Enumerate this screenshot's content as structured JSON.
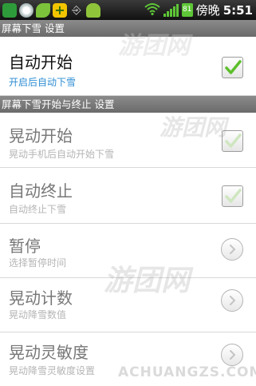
{
  "status_bar": {
    "battery_level": "81",
    "carrier_text": "傍晚",
    "time": "5:51"
  },
  "sections": [
    {
      "header": "屏幕下雪 设置"
    },
    {
      "header": "屏幕下雪开始与终止 设置"
    }
  ],
  "rows": [
    {
      "title": "自动开始",
      "subtitle": "开启后自动下雪",
      "control": "checkbox",
      "checked": true,
      "enabled": true
    },
    {
      "title": "晃动开始",
      "subtitle": "晃动手机后自动开始下雪",
      "control": "checkbox",
      "checked": true,
      "enabled": false
    },
    {
      "title": "自动终止",
      "subtitle": "自动终止下雪",
      "control": "checkbox",
      "checked": true,
      "enabled": false
    },
    {
      "title": "暂停",
      "subtitle": "选择暂停时间",
      "control": "chevron",
      "enabled": false
    },
    {
      "title": "晃动计数",
      "subtitle": "晃动降雪数值",
      "control": "chevron",
      "enabled": false
    },
    {
      "title": "晃动灵敏度",
      "subtitle": "晃动降雪灵敏度设置",
      "control": "chevron",
      "enabled": false
    }
  ],
  "watermark": {
    "text": "游团网",
    "url": "ACHUANGZS.COM"
  },
  "colors": {
    "accent_check": "#5cbf2a",
    "section_header": "#777777",
    "subtitle_blue": "#2f8ed4"
  }
}
